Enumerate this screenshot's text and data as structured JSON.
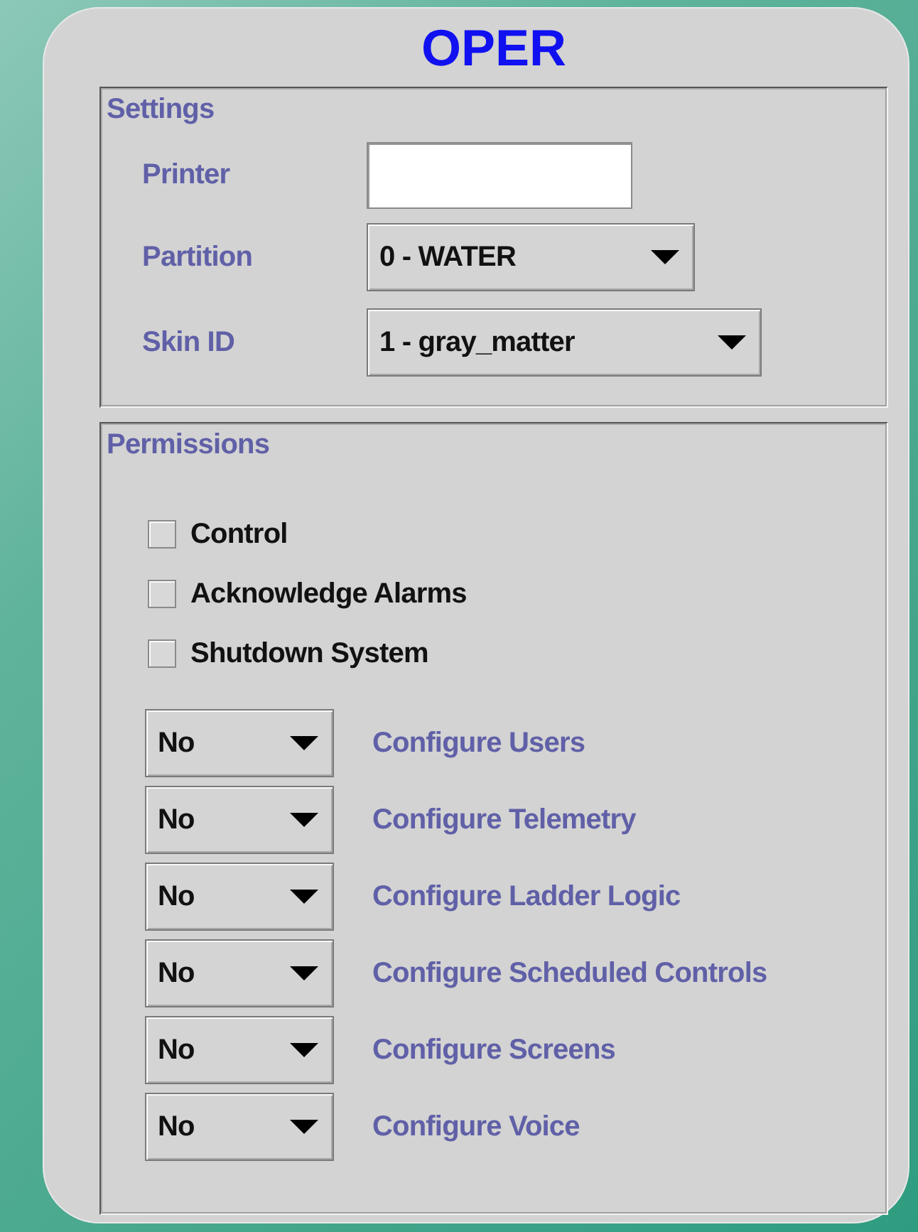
{
  "title": "OPER",
  "settings": {
    "title": "Settings",
    "printer": {
      "label": "Printer"
    },
    "partition": {
      "label": "Partition",
      "value": "0 - WATER"
    },
    "skin": {
      "label": "Skin ID",
      "value": "1 - gray_matter"
    }
  },
  "permissions": {
    "title": "Permissions",
    "checkboxes": [
      {
        "label": "Control",
        "checked": false
      },
      {
        "label": "Acknowledge Alarms",
        "checked": false
      },
      {
        "label": "Shutdown System",
        "checked": false
      }
    ],
    "levels": [
      {
        "value": "No",
        "label": "Configure Users"
      },
      {
        "value": "No",
        "label": "Configure Telemetry"
      },
      {
        "value": "No",
        "label": "Configure Ladder Logic"
      },
      {
        "value": "No",
        "label": "Configure Scheduled Controls"
      },
      {
        "value": "No",
        "label": "Configure Screens"
      },
      {
        "value": "No",
        "label": "Configure Voice"
      }
    ]
  }
}
